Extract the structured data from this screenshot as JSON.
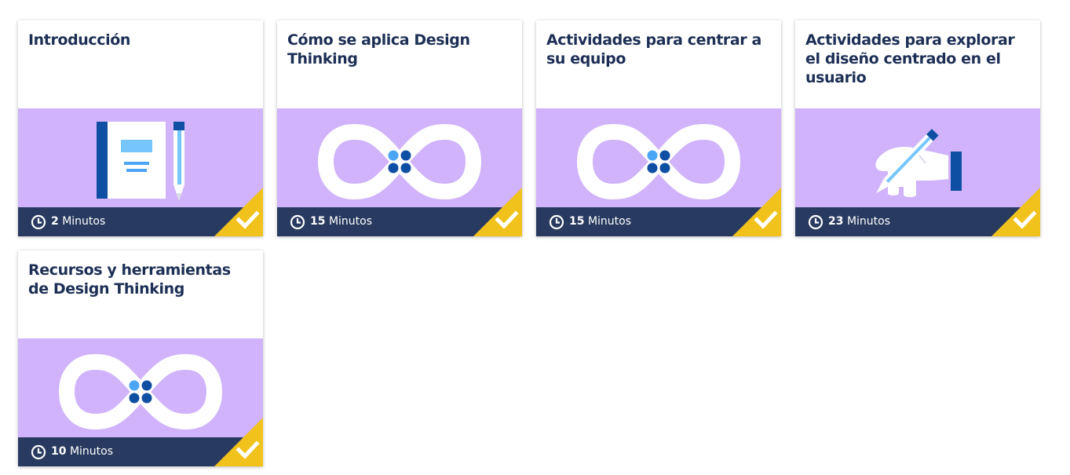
{
  "colors": {
    "title": "#1d2f55",
    "art_bg": "#d0b3fb",
    "footer_bg": "#293a60",
    "complete_badge": "#f1c21b",
    "infinity": "#ffffff",
    "dot_light": "#4ba5f5",
    "dot_dark": "#0f4fa3"
  },
  "cards": [
    {
      "title": "Introducción",
      "duration_value": "2",
      "duration_unit": "Minutos",
      "art_icon": "notebook-pencil-icon",
      "completed": true
    },
    {
      "title": "Cómo se aplica Design Thinking",
      "duration_value": "15",
      "duration_unit": "Minutos",
      "art_icon": "infinity-loop-icon",
      "completed": true
    },
    {
      "title": "Actividades para centrar a su equipo",
      "duration_value": "15",
      "duration_unit": "Minutos",
      "art_icon": "infinity-loop-icon",
      "completed": true
    },
    {
      "title": "Actividades para explorar el diseño centrado en el usuario",
      "duration_value": "23",
      "duration_unit": "Minutos",
      "art_icon": "hand-pencil-icon",
      "completed": true
    },
    {
      "title": "Recursos y herramientas de Design Thinking",
      "duration_value": "10",
      "duration_unit": "Minutos",
      "art_icon": "infinity-loop-icon",
      "completed": true
    }
  ]
}
